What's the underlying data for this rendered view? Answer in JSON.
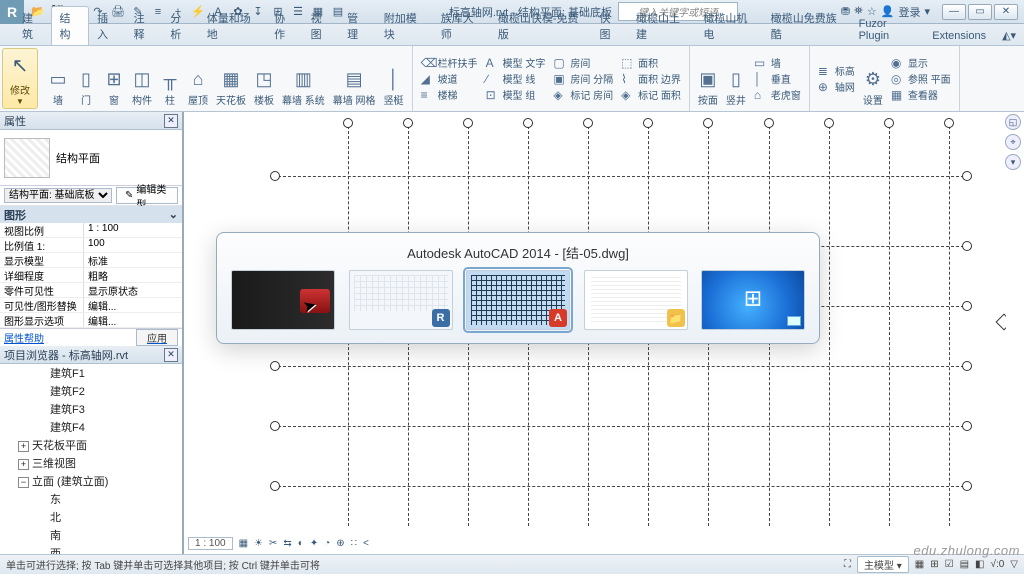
{
  "titlebar": {
    "logo": "R",
    "doc_title": "标高轴网.rvt - 结构平面: 基础底板",
    "search_placeholder": "键入关键字或短语",
    "login": "登录",
    "qat_icons": [
      "folder",
      "save",
      "undo",
      "redo",
      "print",
      "brush",
      "copy",
      "plus",
      "bolt",
      "text",
      "bucket",
      "pin",
      "grid",
      "list",
      "menu",
      "bars",
      "grid2"
    ],
    "right_icons": [
      "road",
      "user",
      "star",
      "person"
    ],
    "win": {
      "min": "—",
      "max": "▭",
      "close": "✕"
    }
  },
  "tabs": [
    "建筑",
    "结构",
    "插入",
    "注释",
    "分析",
    "体量和场地",
    "协作",
    "视图",
    "管理",
    "附加模块",
    "族库大师",
    "橄榄山快模-免费版",
    "快图",
    "橄榄山土建",
    "橄榄山机电",
    "橄榄山免费族酷",
    "Fuzor Plugin",
    "Extensions"
  ],
  "active_tab": 1,
  "ribbon": {
    "modify": "修改",
    "group1": [
      {
        "ic": "▭",
        "label": "墙"
      },
      {
        "ic": "▯",
        "label": "门"
      },
      {
        "ic": "⊞",
        "label": "窗"
      },
      {
        "ic": "◫",
        "label": "构件"
      },
      {
        "ic": "╥",
        "label": "柱"
      },
      {
        "ic": "⌂",
        "label": "屋顶"
      },
      {
        "ic": "▦",
        "label": "天花板"
      },
      {
        "ic": "◳",
        "label": "楼板"
      },
      {
        "ic": "▥",
        "label": "幕墙 系统"
      },
      {
        "ic": "▤",
        "label": "幕墙 网格"
      },
      {
        "ic": "│",
        "label": "竖梃"
      }
    ],
    "group2": [
      {
        "rows": [
          {
            "ic": "⌫",
            "t": "栏杆扶手"
          },
          {
            "ic": "◢",
            "t": "坡道"
          },
          {
            "ic": "≡",
            "t": "楼梯"
          }
        ]
      },
      {
        "rows": [
          {
            "ic": "A",
            "t": "模型 文字"
          },
          {
            "ic": "∕",
            "t": "模型 线"
          },
          {
            "ic": "⊡",
            "t": "模型 组"
          }
        ]
      },
      {
        "rows": [
          {
            "ic": "▢",
            "t": "房间"
          },
          {
            "ic": "▣",
            "t": "房间 分隔"
          },
          {
            "ic": "◈",
            "t": "标记 房间"
          }
        ]
      },
      {
        "rows": [
          {
            "ic": "⬚",
            "t": "面积"
          },
          {
            "ic": "⌇",
            "t": "面积 边界"
          },
          {
            "ic": "◈",
            "t": "标记 面积"
          }
        ]
      }
    ],
    "group3": [
      {
        "ic": "▣",
        "label": "按面"
      },
      {
        "ic": "▯",
        "label": "竖井"
      },
      {
        "rows": [
          {
            "ic": "▭",
            "t": "墙"
          },
          {
            "ic": "│",
            "t": "垂直"
          },
          {
            "ic": "⌂",
            "t": "老虎窗"
          }
        ]
      }
    ],
    "group4": [
      {
        "rows": [
          {
            "ic": "≣",
            "t": "标高"
          },
          {
            "ic": "⊕",
            "t": "轴网"
          }
        ]
      },
      {
        "ic": "⚙",
        "label": "设置"
      },
      {
        "rows": [
          {
            "ic": "◉",
            "t": "显示"
          },
          {
            "ic": "◎",
            "t": "参照 平面"
          },
          {
            "ic": "▦",
            "t": "查看器"
          }
        ]
      }
    ]
  },
  "properties": {
    "title": "属性",
    "type_name": "结构平面",
    "selector": "结构平面: 基础底板",
    "edit_type": "编辑类型",
    "section": "图形",
    "rows": [
      {
        "k": "视图比例",
        "v": "1 : 100"
      },
      {
        "k": "比例值 1:",
        "v": "100"
      },
      {
        "k": "显示模型",
        "v": "标准"
      },
      {
        "k": "详细程度",
        "v": "粗略"
      },
      {
        "k": "零件可见性",
        "v": "显示原状态"
      },
      {
        "k": "可见性/图形替换",
        "v": "编辑..."
      },
      {
        "k": "图形显示选项",
        "v": "编辑..."
      }
    ],
    "help": "属性帮助",
    "apply": "应用"
  },
  "browser": {
    "title": "项目浏览器 - 标高轴网.rvt",
    "nodes": [
      {
        "t": "建筑F1",
        "lvl": 2
      },
      {
        "t": "建筑F2",
        "lvl": 2
      },
      {
        "t": "建筑F3",
        "lvl": 2
      },
      {
        "t": "建筑F4",
        "lvl": 2
      },
      {
        "t": "天花板平面",
        "lvl": 1,
        "exp": "+"
      },
      {
        "t": "三维视图",
        "lvl": 1,
        "exp": "+"
      },
      {
        "t": "立面 (建筑立面)",
        "lvl": 1,
        "exp": "−"
      },
      {
        "t": "东",
        "lvl": 2
      },
      {
        "t": "北",
        "lvl": 2
      },
      {
        "t": "南",
        "lvl": 2
      },
      {
        "t": "西",
        "lvl": 2
      }
    ]
  },
  "viewbar": {
    "zoom": "1 : 100",
    "icons": [
      "⊡",
      "☀",
      "✂",
      "⇆",
      "◐",
      "✦",
      "◔",
      "⊕",
      "∷",
      "<"
    ]
  },
  "statusbar": {
    "hint": "单击可进行选择; 按 Tab 键并单击可选择其他项目; 按 Ctrl 键并单击可将",
    "model_label": "主模型",
    "right_icons": [
      "⛶",
      "▦",
      "⊞",
      "☑",
      "▤",
      "◧",
      "√",
      "⊘",
      "0",
      "▽"
    ]
  },
  "alt_tab": {
    "title": "Autodesk AutoCAD 2014 - [结-05.dwg]",
    "apps": [
      {
        "corner": "",
        "bg": "t1"
      },
      {
        "corner": "R",
        "cbg": "#3a6ea5",
        "bg": "t2"
      },
      {
        "corner": "A",
        "cbg": "#d63b2a",
        "bg": "t3",
        "active": true
      },
      {
        "corner": "📁",
        "cbg": "#f0c24b",
        "bg": "t4"
      },
      {
        "corner": "",
        "bg": "t5"
      }
    ]
  },
  "watermark": "edu.zhulong.com"
}
